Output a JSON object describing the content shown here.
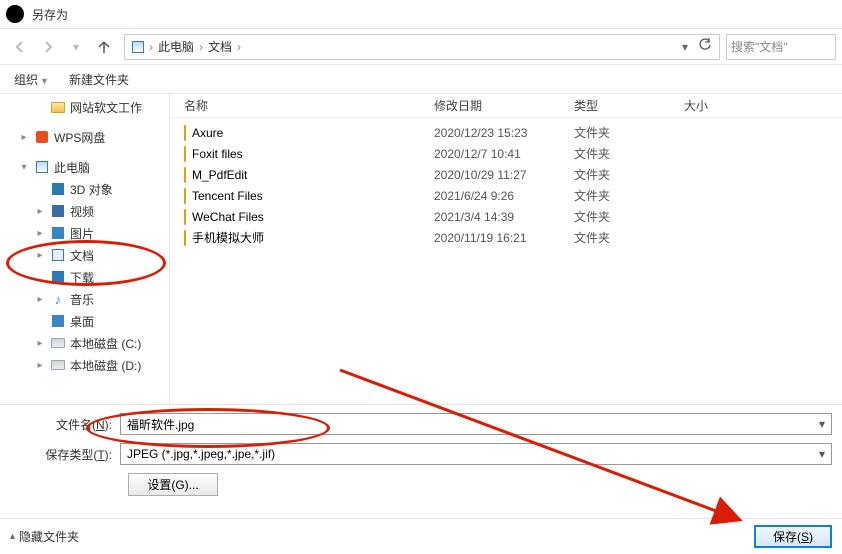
{
  "window": {
    "title": "另存为"
  },
  "breadcrumb": {
    "root_icon": "pc-icon",
    "parts": [
      "此电脑",
      "文档"
    ]
  },
  "search": {
    "placeholder": "搜索\"文档\""
  },
  "toolbar": {
    "organize": "组织",
    "new_folder": "新建文件夹"
  },
  "tree": [
    {
      "icon": "folder",
      "label": "网站软文工作",
      "indent": 34,
      "expander": ""
    },
    {
      "icon": "wps",
      "label": "WPS网盘",
      "indent": 18,
      "expander": ">"
    },
    {
      "icon": "pc",
      "label": "此电脑",
      "indent": 18,
      "expander": "v"
    },
    {
      "icon": "3d",
      "label": "3D 对象",
      "indent": 34,
      "expander": ""
    },
    {
      "icon": "video",
      "label": "视频",
      "indent": 34,
      "expander": ">"
    },
    {
      "icon": "pic",
      "label": "图片",
      "indent": 34,
      "expander": ">"
    },
    {
      "icon": "doc",
      "label": "文档",
      "indent": 34,
      "expander": ">"
    },
    {
      "icon": "down",
      "label": "下载",
      "indent": 34,
      "expander": ""
    },
    {
      "icon": "music",
      "label": "音乐",
      "indent": 34,
      "expander": ">"
    },
    {
      "icon": "desktop",
      "label": "桌面",
      "indent": 34,
      "expander": ""
    },
    {
      "icon": "disk",
      "label": "本地磁盘 (C:)",
      "indent": 34,
      "expander": ">"
    },
    {
      "icon": "disk",
      "label": "本地磁盘 (D:)",
      "indent": 34,
      "expander": ">"
    }
  ],
  "columns": {
    "name": "名称",
    "date": "修改日期",
    "type": "类型",
    "size": "大小"
  },
  "rows": [
    {
      "name": "Axure",
      "date": "2020/12/23 15:23",
      "type": "文件夹"
    },
    {
      "name": "Foxit files",
      "date": "2020/12/7 10:41",
      "type": "文件夹"
    },
    {
      "name": "M_PdfEdit",
      "date": "2020/10/29 11:27",
      "type": "文件夹"
    },
    {
      "name": "Tencent Files",
      "date": "2021/6/24 9:26",
      "type": "文件夹"
    },
    {
      "name": "WeChat Files",
      "date": "2021/3/4 14:39",
      "type": "文件夹"
    },
    {
      "name": "手机模拟大师",
      "date": "2020/11/19 16:21",
      "type": "文件夹"
    }
  ],
  "form": {
    "filename_label_pre": "文件名(",
    "filename_label_key": "N",
    "filename_label_post": "):",
    "filename_value": "福昕软件.jpg",
    "filetype_label_pre": "保存类型(",
    "filetype_label_key": "T",
    "filetype_label_post": "):",
    "filetype_value": "JPEG (*.jpg,*.jpeg,*.jpe,*.jif)",
    "settings_label": "设置(G)..."
  },
  "footer": {
    "hide_folders": "隐藏文件夹",
    "save_pre": "保存(",
    "save_key": "S",
    "save_post": ")"
  }
}
